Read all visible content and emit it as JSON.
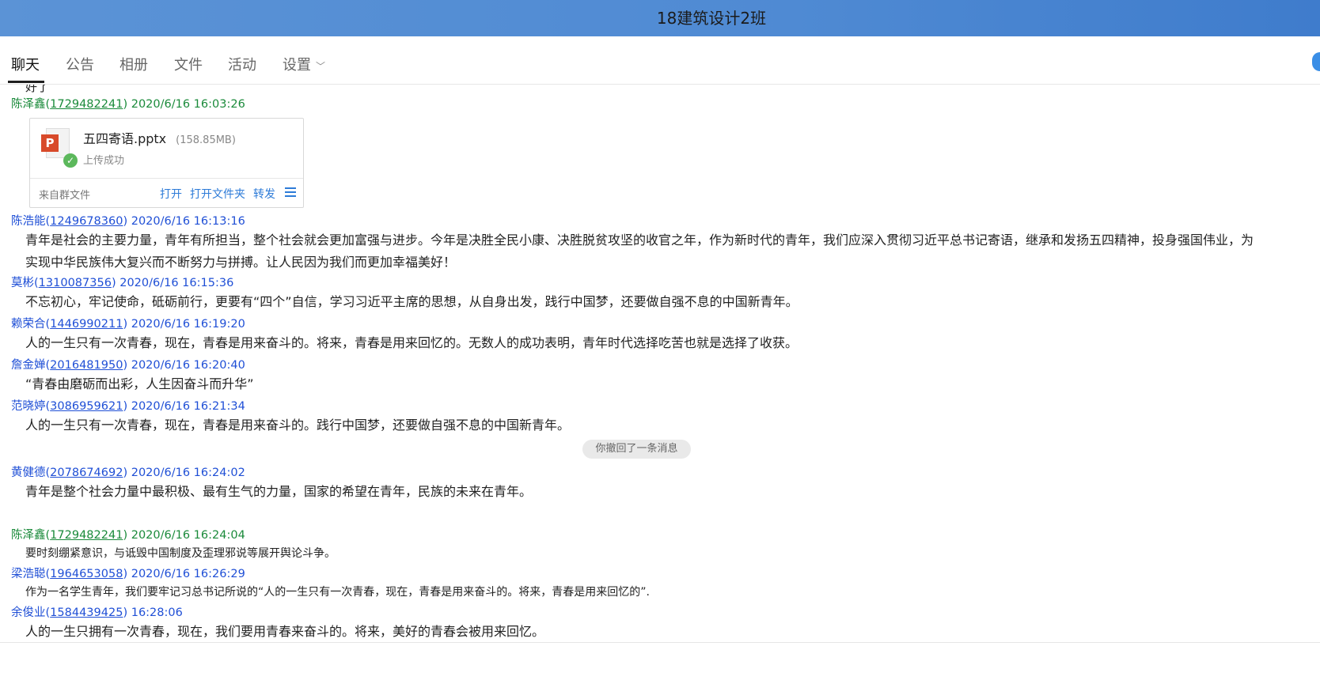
{
  "window": {
    "title": "18建筑设计2班"
  },
  "nav": {
    "tabs": [
      {
        "label": "聊天",
        "active": true
      },
      {
        "label": "公告"
      },
      {
        "label": "相册"
      },
      {
        "label": "文件"
      },
      {
        "label": "活动"
      },
      {
        "label": "设置"
      }
    ],
    "settings_caret": "﹀"
  },
  "colors": {
    "sender_green": "#1a8a3a",
    "sender_blue": "#1f4fd6",
    "link_blue": "#2d7bd8",
    "titlebar": "#4f8ad3"
  },
  "partial_text": "好了",
  "messages": [
    {
      "name": "陈泽鑫",
      "qq": "1729482241",
      "time": "2020/6/16 16:03:26",
      "file": {
        "name": "五四寄语.pptx",
        "size": "(158.85MB)",
        "status": "上传成功",
        "source": "来自群文件",
        "actions": [
          "打开",
          "打开文件夹",
          "转发"
        ],
        "icon": "ppt-file-icon"
      }
    },
    {
      "name": "陈浩能",
      "qq": "1249678360",
      "time": "2020/6/16 16:13:16",
      "lines": [
        "青年是社会的主要力量，青年有所担当，整个社会就会更加富强与进步。今年是决胜全民小康、决胜脱贫攻坚的收官之年，作为新时代的青年，我们应深入贯彻习近平总书记寄语，继承和发扬五四精神，投身强国伟业，为",
        "实现中华民族伟大复兴而不断努力与拼搏。让人民因为我们而更加幸福美好！"
      ]
    },
    {
      "name": "莫彬",
      "qq": "1310087356",
      "time": "2020/6/16 16:15:36",
      "lines": [
        "不忘初心，牢记使命，砥砺前行，更要有“四个”自信，学习习近平主席的思想，从自身出发，践行中国梦，还要做自强不息的中国新青年。"
      ]
    },
    {
      "name": "赖荣合",
      "qq": "1446990211",
      "time": "2020/6/16 16:19:20",
      "lines": [
        "人的一生只有一次青春，现在，青春是用来奋斗的。将来，青春是用来回忆的。无数人的成功表明，青年时代选择吃苦也就是选择了收获。"
      ]
    },
    {
      "name": "詹金婵",
      "qq": "2016481950",
      "time": "2020/6/16 16:20:40",
      "lines": [
        "“青春由磨砺而出彩，人生因奋斗而升华”"
      ]
    },
    {
      "name": "范晓婷",
      "qq": "3086959621",
      "time": "2020/6/16 16:21:34",
      "lines": [
        "人的一生只有一次青春，现在，青春是用来奋斗的。践行中国梦，还要做自强不息的中国新青年。"
      ]
    },
    {
      "name": "黄健德",
      "qq": "2078674692",
      "time": "2020/6/16 16:24:02",
      "lines": [
        "青年是整个社会力量中最积极、最有生气的力量，国家的希望在青年，民族的未来在青年。"
      ]
    },
    {
      "name": "陈泽鑫",
      "qq": "1729482241",
      "time": "2020/6/16 16:24:04",
      "lines": [
        "要时刻绷紧意识，与诋毁中国制度及歪理邪说等展开舆论斗争。"
      ]
    },
    {
      "name": "梁浩聪",
      "qq": "1964653058",
      "time": "2020/6/16 16:26:29",
      "lines": [
        "作为一名学生青年，我们要牢记习总书记所说的“人的一生只有一次青春，现在，青春是用来奋斗的。将来，青春是用来回忆的”."
      ]
    },
    {
      "name": "余俊业",
      "qq": "1584439425",
      "time": "16:28:06",
      "lines": [
        "人的一生只拥有一次青春，现在，我们要用青春来奋斗的。将来，美好的青春会被用来回忆。"
      ]
    }
  ],
  "recall_notice": "你撤回了一条消息"
}
